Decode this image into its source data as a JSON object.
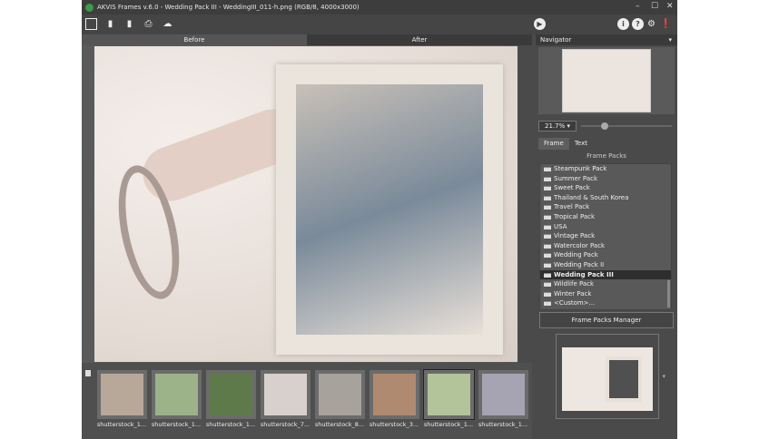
{
  "window": {
    "title": "AKVIS Frames v.6.0 - Wedding Pack III - WeddingIII_011-h.png (RGB/8, 4000x3000)"
  },
  "view_tabs": {
    "before": "Before",
    "after": "After"
  },
  "navigator": {
    "label": "Navigator",
    "zoom": "21.7%"
  },
  "panel_tabs": {
    "frame": "Frame",
    "text": "Text"
  },
  "frame_packs": {
    "heading": "Frame Packs",
    "items": [
      "Steampunk Pack",
      "Summer Pack",
      "Sweet Pack",
      "Thailand & South Korea",
      "Travel Pack",
      "Tropical Pack",
      "USA",
      "Vintage Pack",
      "Watercolor Pack",
      "Wedding Pack",
      "Wedding Pack II",
      "Wedding Pack III",
      "Wildlife Pack",
      "Winter Pack",
      "<Custom>..."
    ],
    "selected": "Wedding Pack III",
    "manager_button": "Frame Packs Manager"
  },
  "filmstrip": [
    "shutterstock_1...",
    "shutterstock_1...",
    "shutterstock_1...",
    "shutterstock_7...",
    "shutterstock_8...",
    "shutterstock_3...",
    "shutterstock_1...",
    "shutterstock_1..."
  ]
}
